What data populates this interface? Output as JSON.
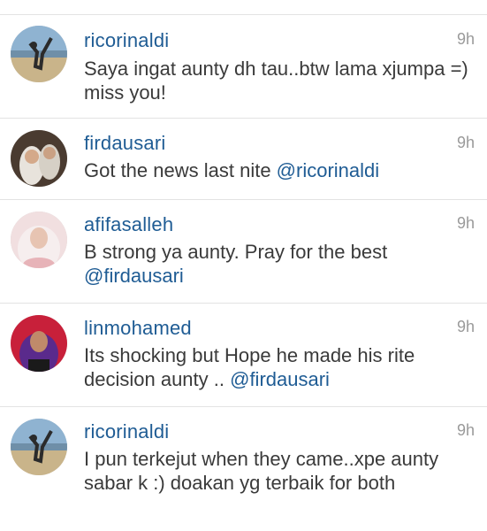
{
  "comments": [
    {
      "username": "ricorinaldi",
      "time": "9h",
      "text": "Saya ingat aunty dh tau..btw lama xjumpa =) miss you!",
      "mention": ""
    },
    {
      "username": "firdausari",
      "time": "9h",
      "text": "Got the news last nite ",
      "mention": "@ricorinaldi"
    },
    {
      "username": "afifasalleh",
      "time": "9h",
      "text": "B strong ya aunty. Pray for the best ",
      "mention": "@firdausari"
    },
    {
      "username": "linmohamed",
      "time": "9h",
      "text": "Its shocking but Hope he made his rite decision aunty .. ",
      "mention": "@firdausari"
    },
    {
      "username": "ricorinaldi",
      "time": "9h",
      "text": "I pun terkejut when they came..xpe aunty sabar k :) doakan yg terbaik for both",
      "mention": ""
    }
  ],
  "colors": {
    "username": "#1f5c94",
    "text": "#3a3a3a",
    "time": "#9a9a9a",
    "divider": "#e3e3e3"
  }
}
